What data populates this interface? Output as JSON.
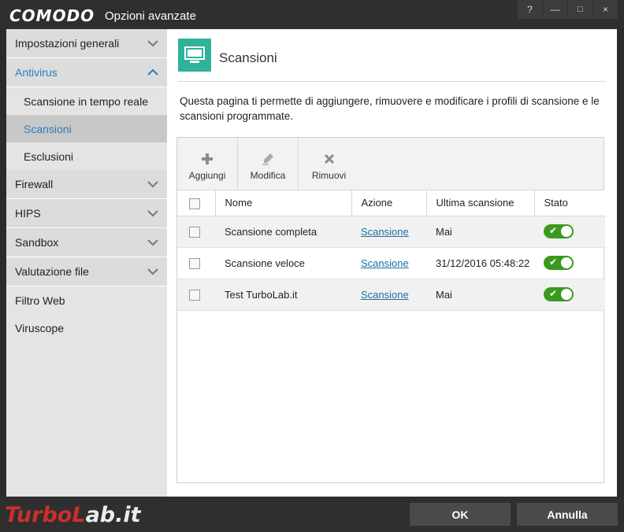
{
  "window": {
    "brand": "COMODO",
    "title": "Opzioni avanzate",
    "buttons": [
      "?",
      "—",
      "□",
      "×"
    ]
  },
  "sidebar": {
    "items": [
      {
        "label": "Impostazioni generali",
        "expanded": false
      },
      {
        "label": "Antivirus",
        "expanded": true,
        "children": [
          "Scansione in tempo reale",
          "Scansioni",
          "Esclusioni"
        ],
        "selected_child": "Scansioni"
      },
      {
        "label": "Firewall",
        "expanded": false
      },
      {
        "label": "HIPS",
        "expanded": false
      },
      {
        "label": "Sandbox",
        "expanded": false
      },
      {
        "label": "Valutazione file",
        "expanded": false
      },
      {
        "label": "Filtro Web"
      },
      {
        "label": "Viruscope"
      }
    ]
  },
  "main": {
    "title": "Scansioni",
    "icon": "monitor-icon",
    "description": "Questa pagina ti permette di aggiungere, rimuovere e modificare i profili di scansione e le scansioni programmate.",
    "toolbar": {
      "add": "Aggiungi",
      "edit": "Modifica",
      "remove": "Rimuovi"
    },
    "table": {
      "columns": [
        "Nome",
        "Azione",
        "Ultima scansione",
        "Stato"
      ],
      "rows": [
        {
          "name": "Scansione completa",
          "action": "Scansione",
          "last": "Mai",
          "enabled": true
        },
        {
          "name": "Scansione veloce",
          "action": "Scansione",
          "last": "31/12/2016 05:48:22",
          "enabled": true
        },
        {
          "name": "Test TurboLab.it",
          "action": "Scansione",
          "last": "Mai",
          "enabled": true
        }
      ]
    }
  },
  "footer": {
    "ok": "OK",
    "cancel": "Annulla",
    "watermark_a": "TurboL",
    "watermark_b": "ab.it"
  },
  "colors": {
    "accent": "#2a7dbd",
    "icon_bg": "#2eb39a",
    "toggle_on": "#3a9a1e",
    "link": "#1d6fa5"
  }
}
